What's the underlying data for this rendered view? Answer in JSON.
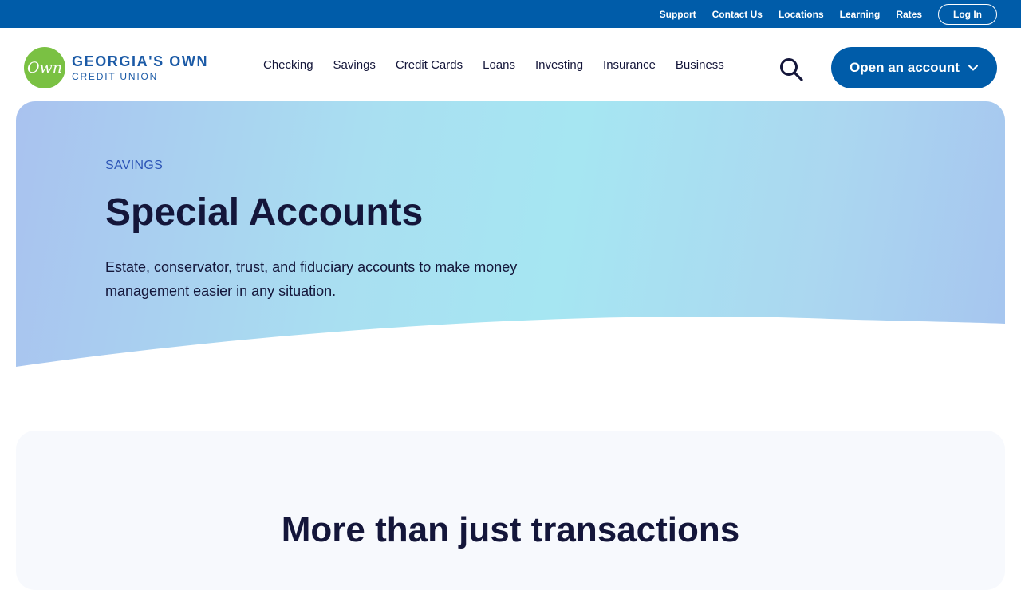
{
  "utility_nav": {
    "links": [
      "Support",
      "Contact Us",
      "Locations",
      "Learning",
      "Rates"
    ],
    "login_label": "Log In"
  },
  "header": {
    "logo": {
      "mark": "Own",
      "line1": "GEORGIA'S OWN",
      "line2": "CREDIT UNION"
    },
    "nav": [
      "Checking",
      "Savings",
      "Credit Cards",
      "Loans",
      "Investing",
      "Insurance",
      "Business"
    ],
    "search_icon": "search-icon",
    "cta_label": "Open an account"
  },
  "hero": {
    "eyebrow": "SAVINGS",
    "title": "Special Accounts",
    "description": "Estate, conservator, trust, and fiduciary accounts to make money management easier in any situation."
  },
  "section": {
    "title": "More than just transactions"
  },
  "colors": {
    "brand_blue": "#005ca9",
    "logo_green": "#7ac143",
    "text_dark": "#14163a",
    "eyebrow_blue": "#2c54b6"
  }
}
